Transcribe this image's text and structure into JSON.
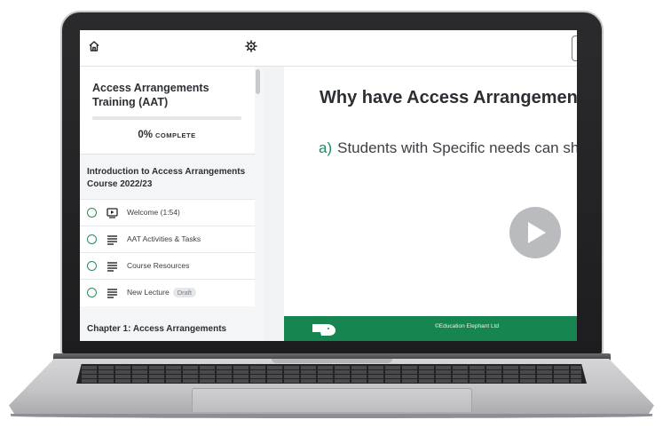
{
  "sidebar": {
    "course_title": "Access Arrangements Training (AAT)",
    "progress": {
      "percent_value": 0,
      "percent_label": "0%",
      "complete_label": "COMPLETE"
    },
    "sections": [
      {
        "title": "Introduction to Access Arrangements Course 2022/23",
        "lectures": [
          {
            "label": "Welcome (1:54)",
            "icon": "video-icon",
            "badge": ""
          },
          {
            "label": "AAT Activities & Tasks",
            "icon": "text-lines-icon",
            "badge": ""
          },
          {
            "label": "Course Resources",
            "icon": "text-lines-icon",
            "badge": ""
          },
          {
            "label": "New Lecture",
            "icon": "text-lines-icon",
            "badge": "Draft"
          }
        ]
      },
      {
        "title": "Chapter 1: Access Arrangements"
      }
    ]
  },
  "slide": {
    "title": "Why have Access Arrangemen",
    "bullet_marker": "a)",
    "bullet_text": "Students with Specific needs can sho",
    "footer_copyright": "©Education Elephant Ltd"
  },
  "icons": {
    "home": "home-icon",
    "settings": "gear-icon",
    "play": "play-icon",
    "logo": "education-elephant-logo"
  },
  "colors": {
    "accent_green": "#17854f",
    "ring_green": "#2a8a5f"
  }
}
